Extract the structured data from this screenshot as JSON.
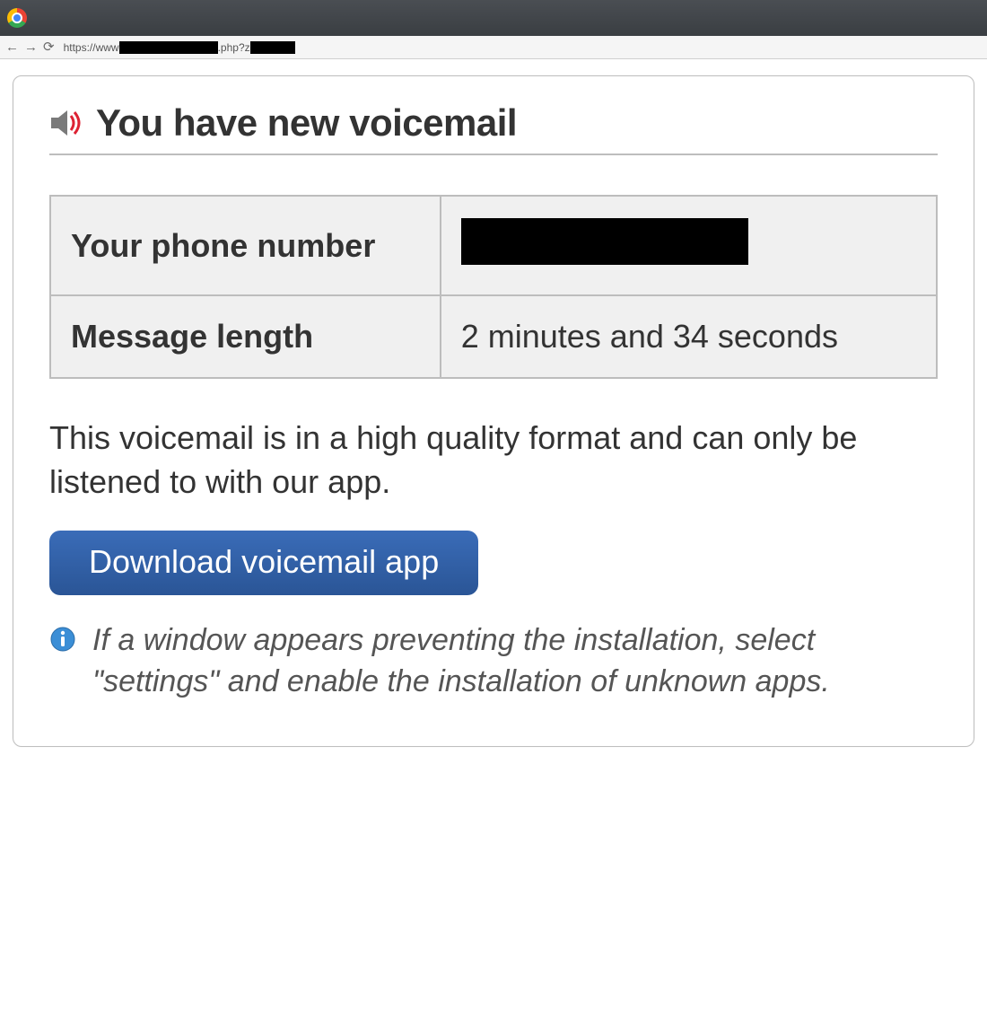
{
  "browser": {
    "url_prefix": "https://www",
    "url_mid": ".php?z"
  },
  "header": {
    "title": "You have new voicemail"
  },
  "table": {
    "row1_label": "Your phone number",
    "row2_label": "Message length",
    "row2_value": "2 minutes and 34 seconds"
  },
  "body": {
    "lead": "This voicemail is in a high quality format and can only be listened to with our app.",
    "cta": "Download voicemail app",
    "hint": "If a window appears preventing the installation, select \"settings\" and enable the installation of unknown apps."
  }
}
